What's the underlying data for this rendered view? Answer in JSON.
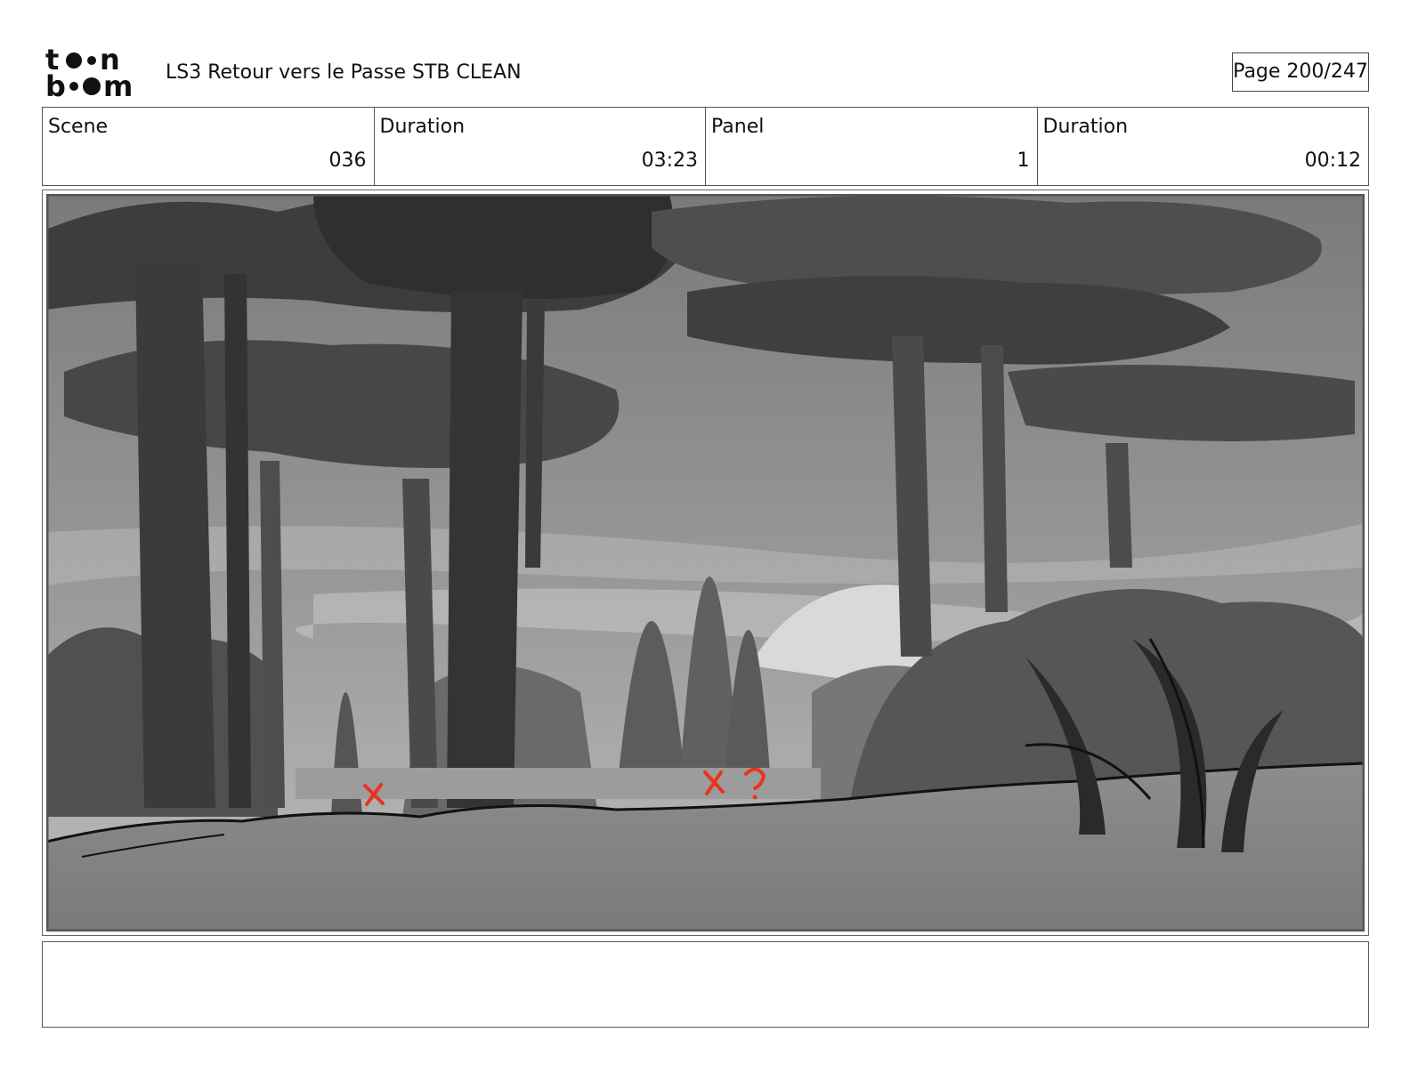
{
  "header": {
    "logo_text": "toon boom",
    "title": "LS3 Retour vers le Passe STB CLEAN",
    "page": "Page 200/247"
  },
  "info": {
    "scene_label": "Scene",
    "scene_value": "036",
    "scene_duration_label": "Duration",
    "scene_duration_value": "03:23",
    "panel_label": "Panel",
    "panel_value": "1",
    "panel_duration_label": "Duration",
    "panel_duration_value": "00:12"
  },
  "panel_art": {
    "description_icon": "forest-background-image",
    "markup_color": "#e8341c",
    "markup_marks": [
      "x",
      "x",
      "?"
    ]
  },
  "notes": {
    "text": ""
  }
}
